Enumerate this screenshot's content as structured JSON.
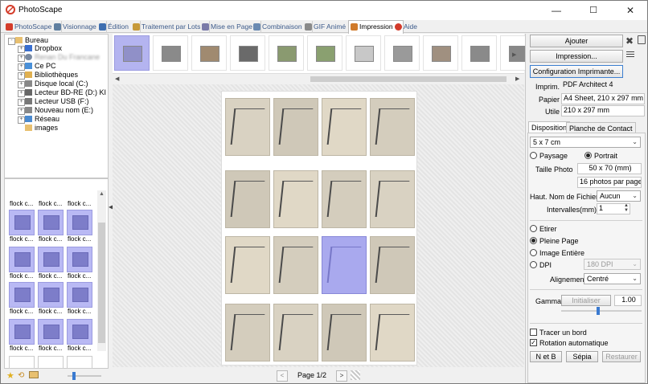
{
  "app": {
    "title": "PhotoScape"
  },
  "window_controls": {
    "minimize": "—",
    "maximize": "☐",
    "close": "✕"
  },
  "tabs": [
    {
      "label": "PhotoScape",
      "color": "#d43c2a"
    },
    {
      "label": "Visionnage",
      "color": "#5f7fa0"
    },
    {
      "label": "Édition",
      "color": "#3f6fb0"
    },
    {
      "label": "Traitement par Lots",
      "color": "#c79a3a"
    },
    {
      "label": "Mise en Page",
      "color": "#7a7aa8"
    },
    {
      "label": "Combinaison",
      "color": "#6a8ab2"
    },
    {
      "label": "GIF Animé",
      "color": "#8a8a8a"
    },
    {
      "label": "Impression",
      "color": "#d07a2a"
    },
    {
      "label": "Aide",
      "color": "#d23a2a"
    }
  ],
  "tree": [
    {
      "label": "Bureau",
      "level": 0,
      "expand": "-"
    },
    {
      "label": "Dropbox",
      "level": 1,
      "expand": "+"
    },
    {
      "label": "Ce PC",
      "level": 1,
      "expand": "+"
    },
    {
      "label": "Bibliothèques",
      "level": 1,
      "expand": "+"
    },
    {
      "label": "Disque local (C:)",
      "level": 1,
      "expand": "+"
    },
    {
      "label": "Lecteur BD-RE (D:) KI",
      "level": 1,
      "expand": "+"
    },
    {
      "label": "Lecteur USB (F:)",
      "level": 1,
      "expand": "+"
    },
    {
      "label": "Nouveau nom (E:)",
      "level": 1,
      "expand": "+"
    },
    {
      "label": "Réseau",
      "level": 1,
      "expand": "+"
    },
    {
      "label": "images",
      "level": 1,
      "expand": ""
    }
  ],
  "tree_blurred_label": "Renan Du Francane",
  "thumb_label": "flock c...",
  "page_nav": {
    "page_label": "Page 1/2",
    "prev": "<",
    "next": ">"
  },
  "right": {
    "add_button": "Ajouter",
    "print_button": "Impression...",
    "printer_config_button": "Configuration Imprimante...",
    "printer_label": "Imprim.",
    "printer_value": "PDF Architect 4",
    "paper_label": "Papier",
    "paper_value": "A4 Sheet, 210 x 297 mm",
    "usable_label": "Utile",
    "usable_value": "210 x 297 mm",
    "tab_layout": "Disposition",
    "tab_contact": "Planche de Contact",
    "size_select": "5 x 7 cm",
    "landscape": "Paysage",
    "portrait": "Portrait",
    "photo_size_label": "Taille Photo",
    "photo_size_value": "50 x 70 (mm)",
    "per_page": "16 photos par page",
    "filename_height_label": "Haut. Nom de Fichier",
    "filename_height_value": "Aucun",
    "intervals_label": "Intervalles(mm)",
    "intervals_value": "1",
    "stretch": "Etirer",
    "full_page": "Pleine Page",
    "whole_image": "Image Entière",
    "dpi": "DPI",
    "dpi_value": "180 DPI",
    "alignment_label": "Alignement",
    "alignment_value": "Centré",
    "gamma_label": "Gamma",
    "init_button": "Initialiser",
    "gamma_value": "1.00",
    "border_label": "Tracer un bord",
    "auto_rotate_label": "Rotation automatique",
    "bw_button": "N et B",
    "sepia_button": "Sépia",
    "restore_button": "Restaurer"
  }
}
